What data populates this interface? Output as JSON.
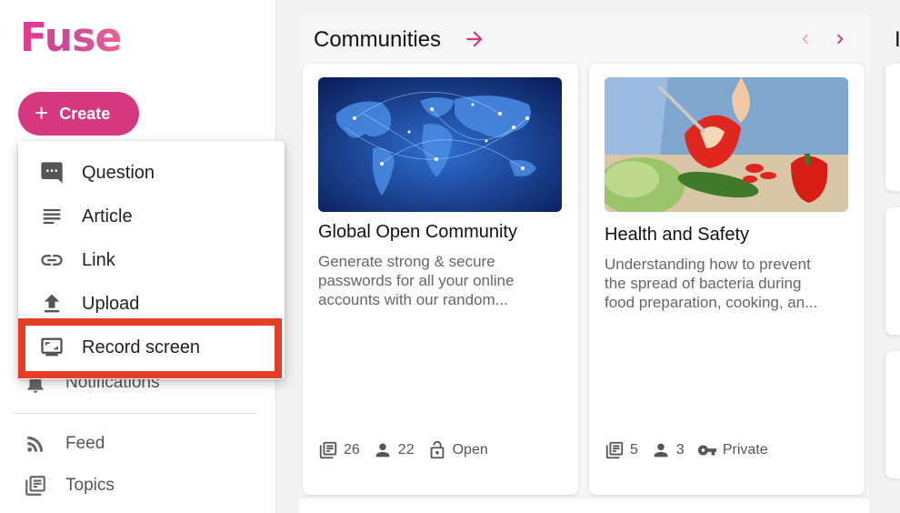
{
  "app": {
    "logo_text": "Fuse",
    "brand_color": "#d6377f",
    "highlight_color": "#e53e25"
  },
  "sidebar": {
    "create_label": "Create",
    "create_icon": "plus-icon",
    "items": [
      {
        "label": "Notifications",
        "icon": "bell-icon"
      },
      {
        "label": "Feed",
        "icon": "rss-icon"
      },
      {
        "label": "Topics",
        "icon": "topics-icon"
      }
    ]
  },
  "create_menu": {
    "items": [
      {
        "label": "Question",
        "icon": "comment-icon"
      },
      {
        "label": "Article",
        "icon": "article-icon"
      },
      {
        "label": "Link",
        "icon": "link-icon"
      },
      {
        "label": "Upload",
        "icon": "upload-icon"
      },
      {
        "label": "Record screen",
        "icon": "screen-record-icon"
      }
    ]
  },
  "communities": {
    "title": "Communities",
    "cards": [
      {
        "title": "Global Open Community",
        "description_lines": [
          "Generate strong & secure",
          "passwords for all your online",
          "accounts with our random..."
        ],
        "image": "world-map-image",
        "stats": {
          "posts": "26",
          "members": "22",
          "access": "Open"
        },
        "access_icon": "lock-open-icon"
      },
      {
        "title": "Health and Safety",
        "description_lines": [
          "Understanding how to prevent",
          "the spread of bacteria during",
          "food preparation, cooking, an..."
        ],
        "image": "cutting-peppers-image",
        "stats": {
          "posts": "5",
          "members": "3",
          "access": "Private"
        },
        "access_icon": "key-icon"
      }
    ]
  },
  "right_panel": {
    "title_fragment": "I"
  }
}
